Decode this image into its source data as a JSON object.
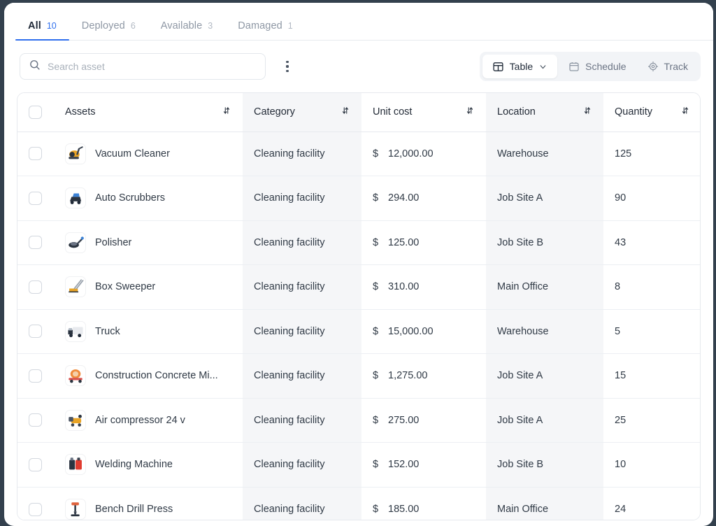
{
  "tabs": [
    {
      "label": "All",
      "count": "10",
      "active": true,
      "name": "tab-all"
    },
    {
      "label": "Deployed",
      "count": "6",
      "active": false,
      "name": "tab-deployed"
    },
    {
      "label": "Available",
      "count": "3",
      "active": false,
      "name": "tab-available"
    },
    {
      "label": "Damaged",
      "count": "1",
      "active": false,
      "name": "tab-damaged"
    }
  ],
  "toolbar": {
    "search": {
      "value": "",
      "placeholder": "Search asset",
      "icon": "search-icon"
    },
    "more_menu_icon": "kebab-menu-icon",
    "views": [
      {
        "label": "Table",
        "icon": "table-layout-icon",
        "active": true,
        "caret": true,
        "name": "view-table"
      },
      {
        "label": "Schedule",
        "icon": "calendar-icon",
        "active": false,
        "caret": false,
        "name": "view-schedule"
      },
      {
        "label": "Track",
        "icon": "target-crosshair-icon",
        "active": false,
        "caret": false,
        "name": "view-track"
      }
    ]
  },
  "table": {
    "select_all_checkbox": "unchecked",
    "sort_icon": "sort-updown-icon",
    "columns": [
      {
        "label": "Assets",
        "shaded": false,
        "sortable": true
      },
      {
        "label": "Category",
        "shaded": true,
        "sortable": true
      },
      {
        "label": "Unit cost",
        "shaded": false,
        "sortable": true
      },
      {
        "label": "Location",
        "shaded": true,
        "sortable": true
      },
      {
        "label": "Quantity",
        "shaded": false,
        "sortable": true
      }
    ],
    "currency_symbol": "$",
    "rows": [
      {
        "asset": "Vacuum Cleaner",
        "thumb": "vacuum-cleaner-photo",
        "category": "Cleaning facility",
        "cost": "12,000.00",
        "location": "Warehouse",
        "quantity": "125"
      },
      {
        "asset": "Auto Scrubbers",
        "thumb": "auto-scrubber-photo",
        "category": "Cleaning facility",
        "cost": "294.00",
        "location": "Job Site A",
        "quantity": "90"
      },
      {
        "asset": "Polisher",
        "thumb": "polisher-photo",
        "category": "Cleaning facility",
        "cost": "125.00",
        "location": "Job Site B",
        "quantity": "43"
      },
      {
        "asset": "Box Sweeper",
        "thumb": "box-sweeper-photo",
        "category": "Cleaning facility",
        "cost": "310.00",
        "location": "Main Office",
        "quantity": "8"
      },
      {
        "asset": "Truck",
        "thumb": "truck-photo",
        "category": "Cleaning facility",
        "cost": "15,000.00",
        "location": "Warehouse",
        "quantity": "5"
      },
      {
        "asset": "Construction Concrete Mi...",
        "thumb": "concrete-mixer-photo",
        "category": "Cleaning facility",
        "cost": "1,275.00",
        "location": "Job Site A",
        "quantity": "15"
      },
      {
        "asset": "Air compressor 24 v",
        "thumb": "air-compressor-photo",
        "category": "Cleaning facility",
        "cost": "275.00",
        "location": "Job Site A",
        "quantity": "25"
      },
      {
        "asset": "Welding Machine",
        "thumb": "welding-machine-photo",
        "category": "Cleaning facility",
        "cost": "152.00",
        "location": "Job Site B",
        "quantity": "10"
      },
      {
        "asset": "Bench Drill Press",
        "thumb": "bench-drill-press-photo",
        "category": "Cleaning facility",
        "cost": "185.00",
        "location": "Main Office",
        "quantity": "24"
      }
    ]
  },
  "colors": {
    "accent": "#2f6fed",
    "text": "#303a46",
    "muted": "#8e97a4",
    "shaded_column": "#f5f6f8",
    "border": "#e6e9ee",
    "page_background": "#33404d"
  }
}
